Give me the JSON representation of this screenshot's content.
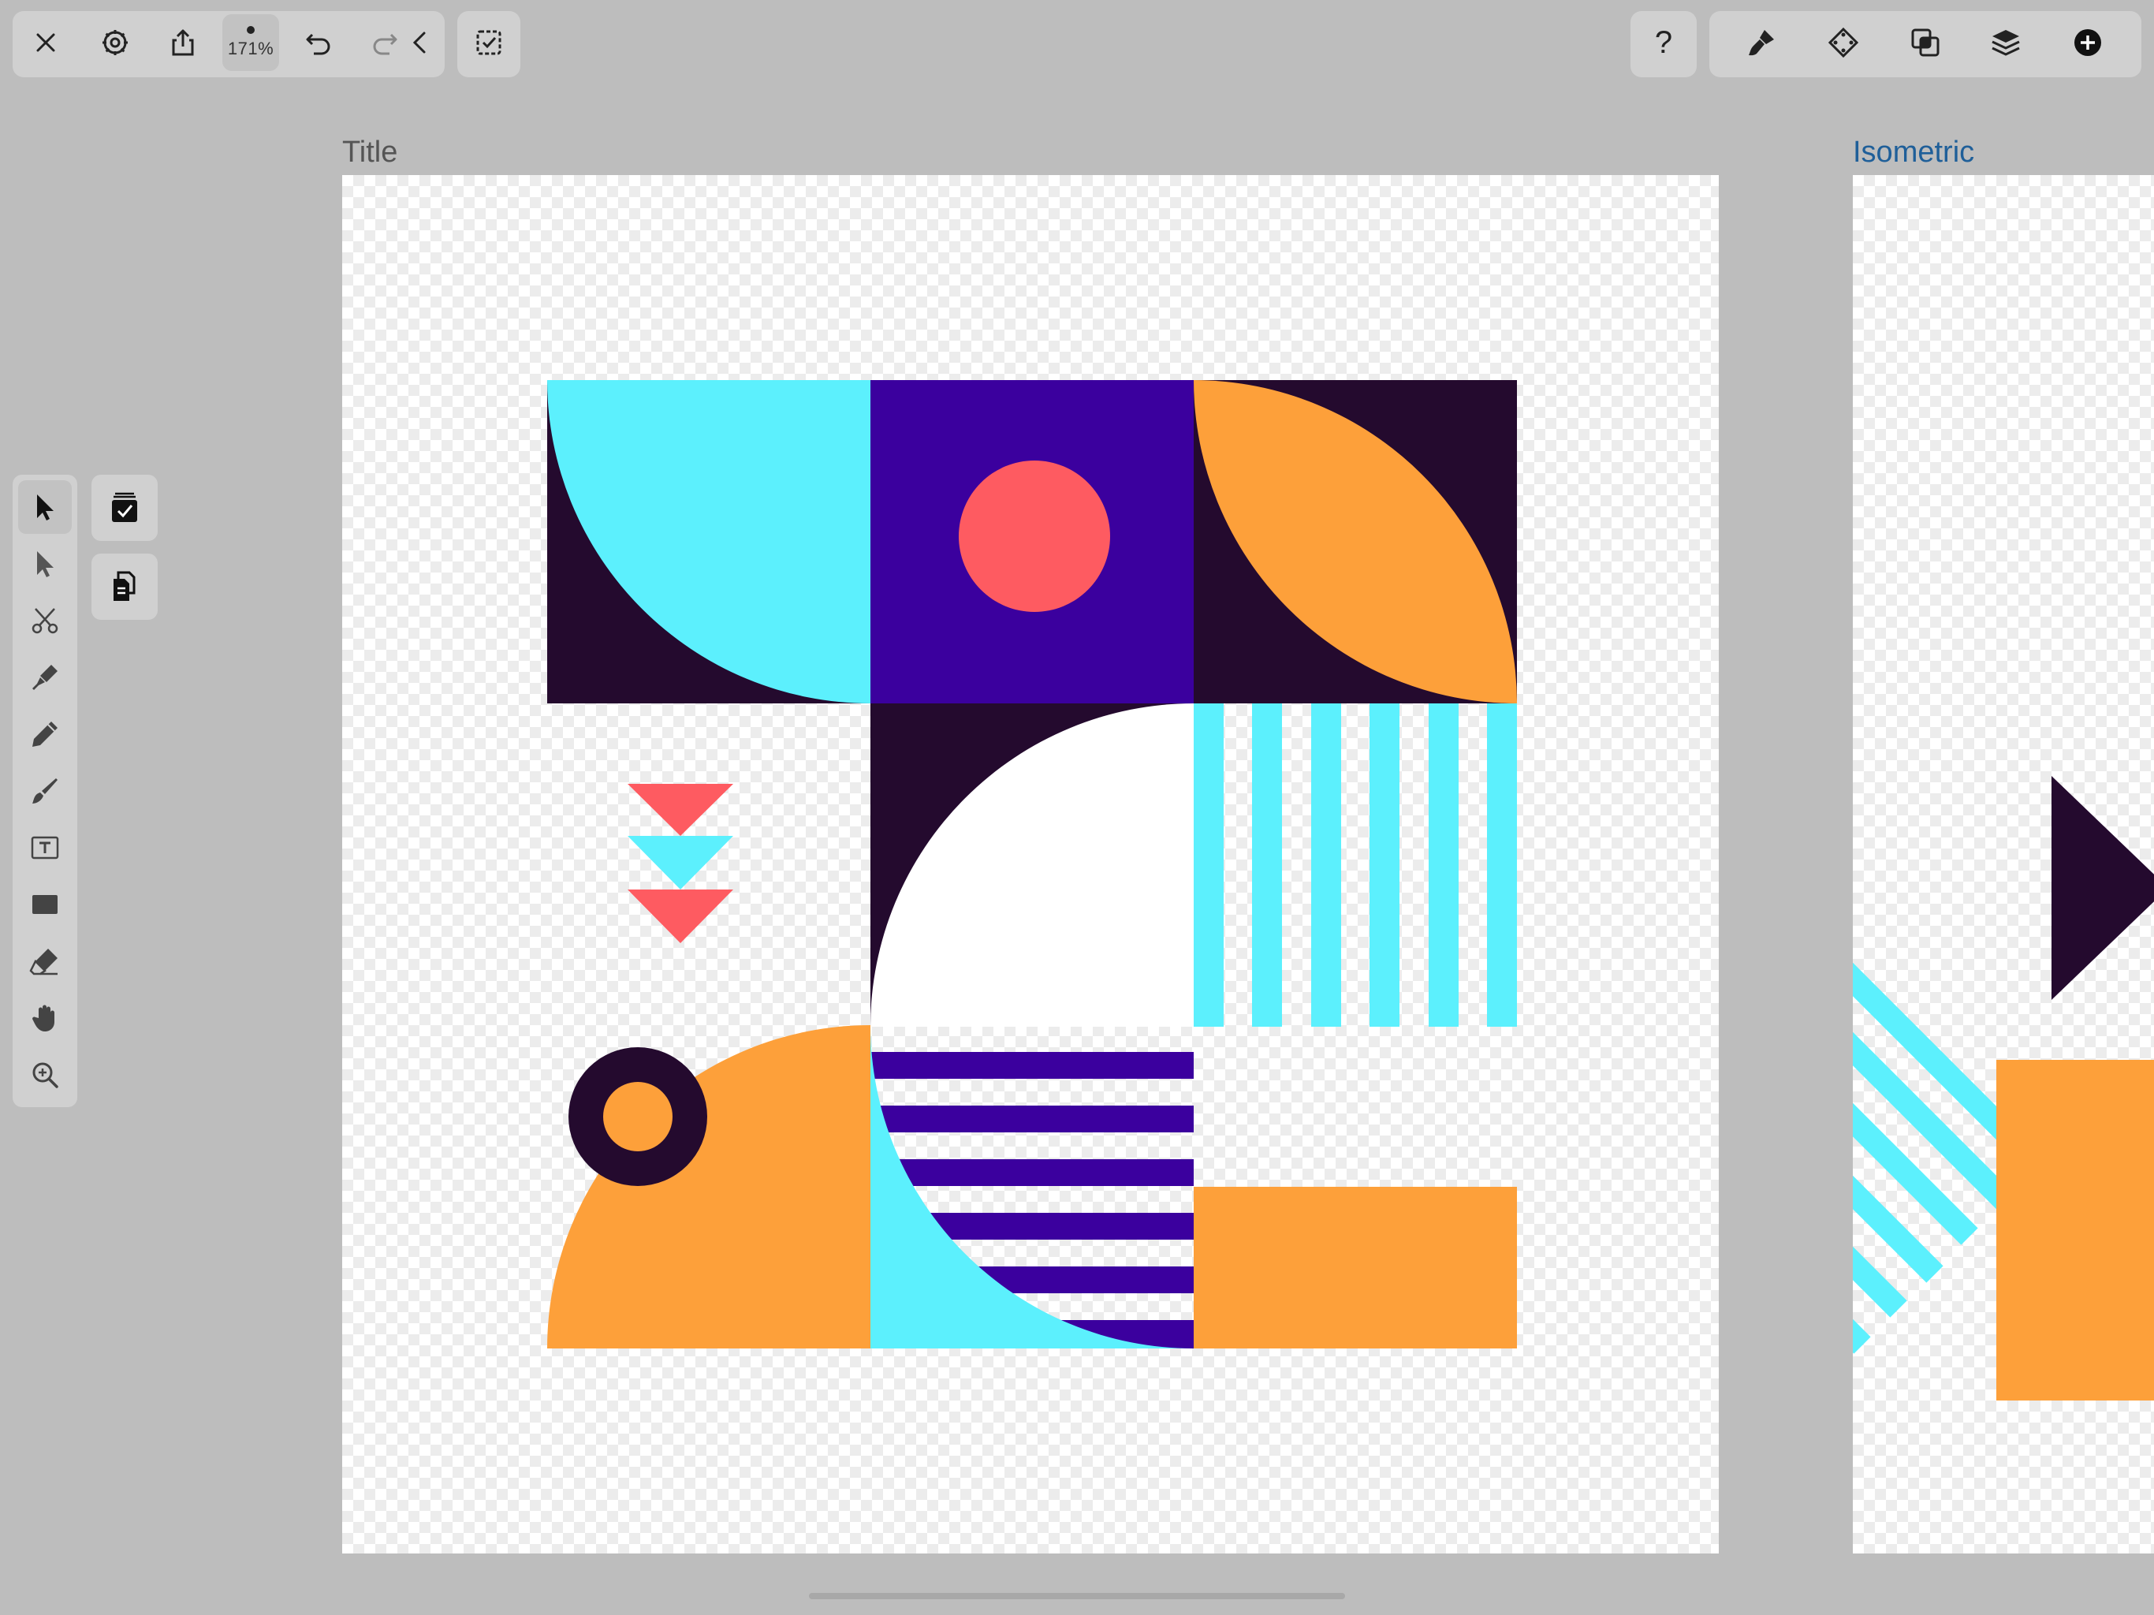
{
  "toolbar": {
    "left": {
      "close_icon": "close-icon",
      "settings_icon": "gear-icon",
      "share_icon": "share-icon",
      "zoom_level": "171%",
      "undo_icon": "undo-icon",
      "redo_icon": "redo-icon",
      "collapse_icon": "chevron-left-icon",
      "select_mode_icon": "checkbox-icon"
    },
    "right": {
      "help_label": "?",
      "style_icon": "brush-icon",
      "symbol_icon": "diamond-icon",
      "boolean_icon": "combine-icon",
      "layers_icon": "layers-icon",
      "add_icon": "plus-circle-icon"
    }
  },
  "tools": [
    {
      "name": "selection",
      "icon": "arrow-icon",
      "active": true
    },
    {
      "name": "direct-selection",
      "icon": "arrow-outline-icon",
      "active": false
    },
    {
      "name": "scissors",
      "icon": "scissors-icon",
      "active": false
    },
    {
      "name": "pen",
      "icon": "pen-nib-icon",
      "active": false
    },
    {
      "name": "pencil",
      "icon": "pencil-icon",
      "active": false
    },
    {
      "name": "brush",
      "icon": "brush-icon",
      "active": false
    },
    {
      "name": "text",
      "icon": "text-box-icon",
      "active": false
    },
    {
      "name": "shape",
      "icon": "rectangle-icon",
      "active": false
    },
    {
      "name": "eraser",
      "icon": "eraser-icon",
      "active": false
    },
    {
      "name": "hand",
      "icon": "hand-icon",
      "active": false
    },
    {
      "name": "zoom",
      "icon": "magnifier-icon",
      "active": false
    }
  ],
  "side_actions": [
    {
      "name": "select-all",
      "icon": "stack-check-icon"
    },
    {
      "name": "duplicate",
      "icon": "copy-icon"
    }
  ],
  "artboards": [
    {
      "title": "Title",
      "active": false,
      "title_color": "#555555"
    },
    {
      "title": "Isometric",
      "active": true,
      "title_color": "#1f5f99"
    }
  ],
  "colors": {
    "cyan": "#5cf0fd",
    "dark_purple": "#240a2e",
    "indigo": "#3b009e",
    "coral": "#fe5b61",
    "orange": "#fda03a",
    "background": "#bdbdbd",
    "panel": "#d0d0d0"
  }
}
